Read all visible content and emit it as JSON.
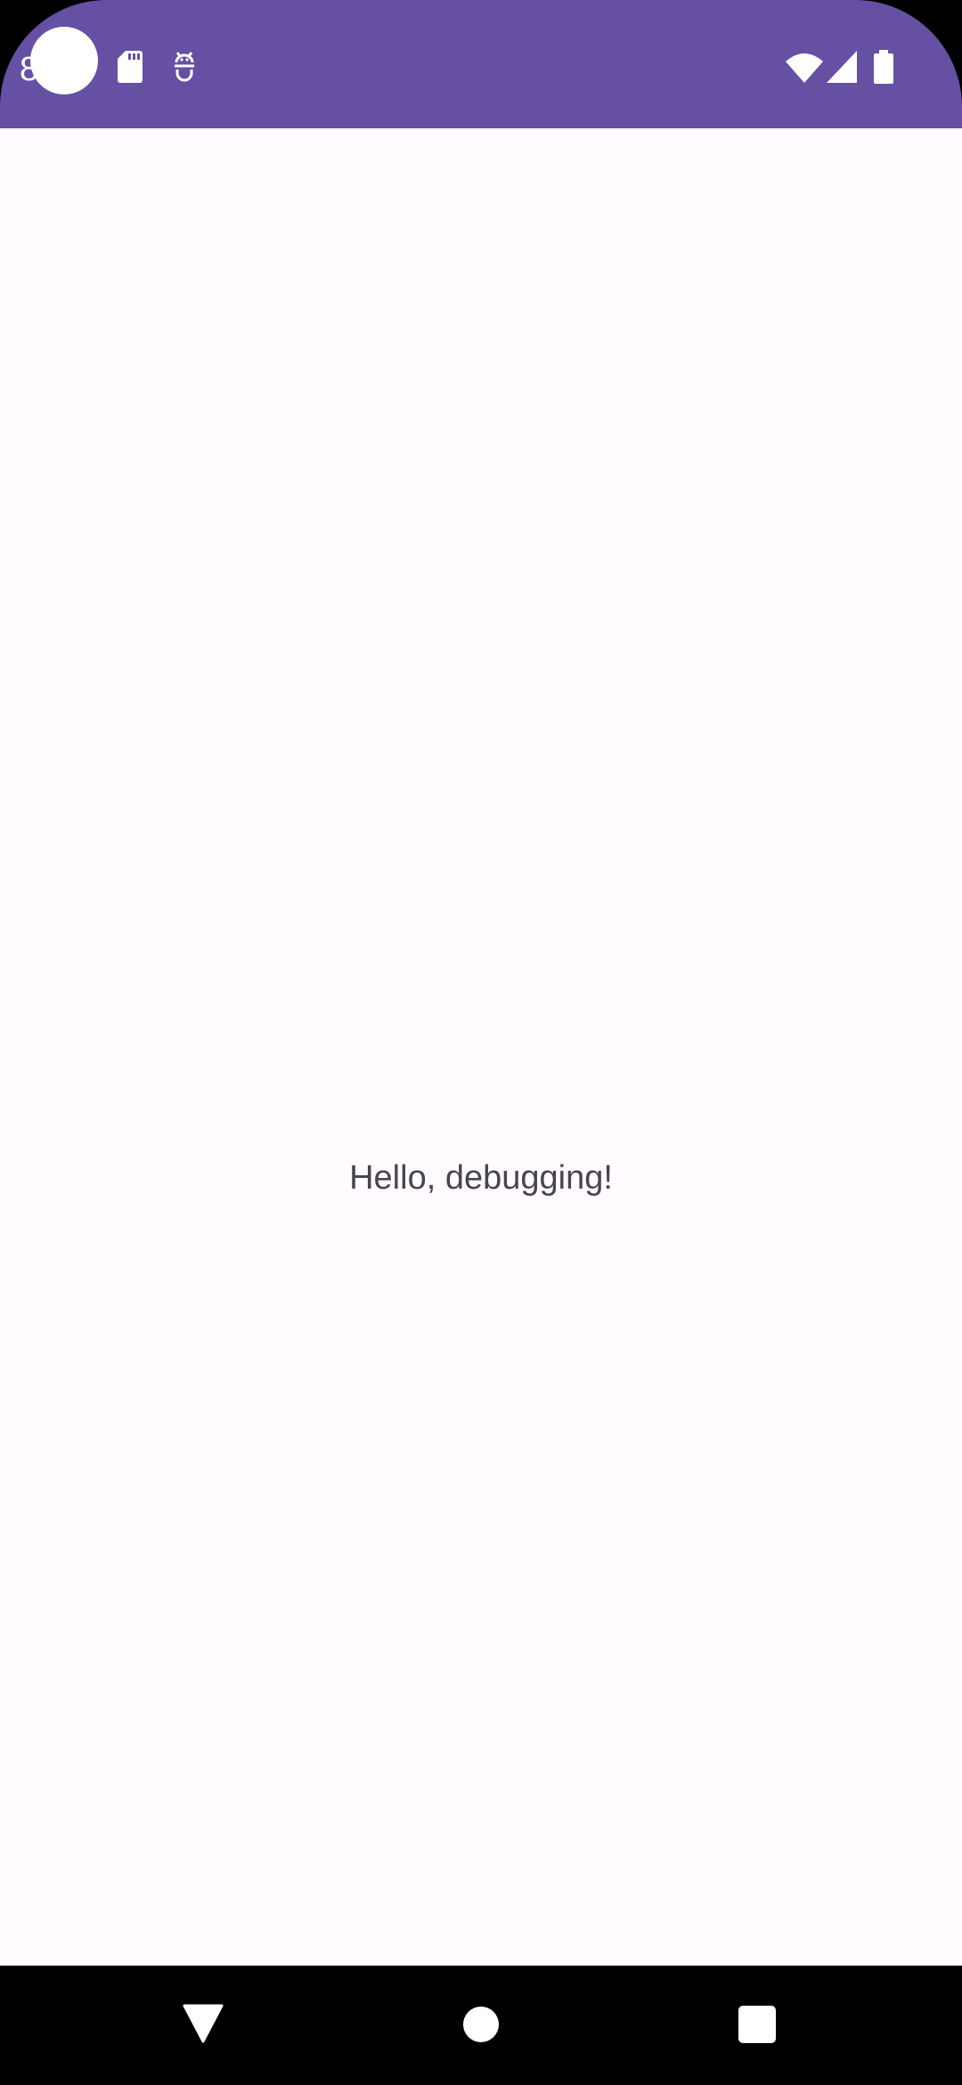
{
  "status_bar": {
    "time": "8",
    "background": "#6650a4",
    "left_icons": [
      "sd-card-icon",
      "android-debug-icon"
    ],
    "right_icons": [
      "wifi-icon",
      "cellular-signal-icon",
      "battery-icon"
    ]
  },
  "content": {
    "greeting": "Hello, debugging!",
    "background": "#fffbfe",
    "text_color": "#49454f"
  },
  "nav_bar": {
    "buttons": [
      "back-icon",
      "home-icon",
      "recents-icon"
    ]
  }
}
